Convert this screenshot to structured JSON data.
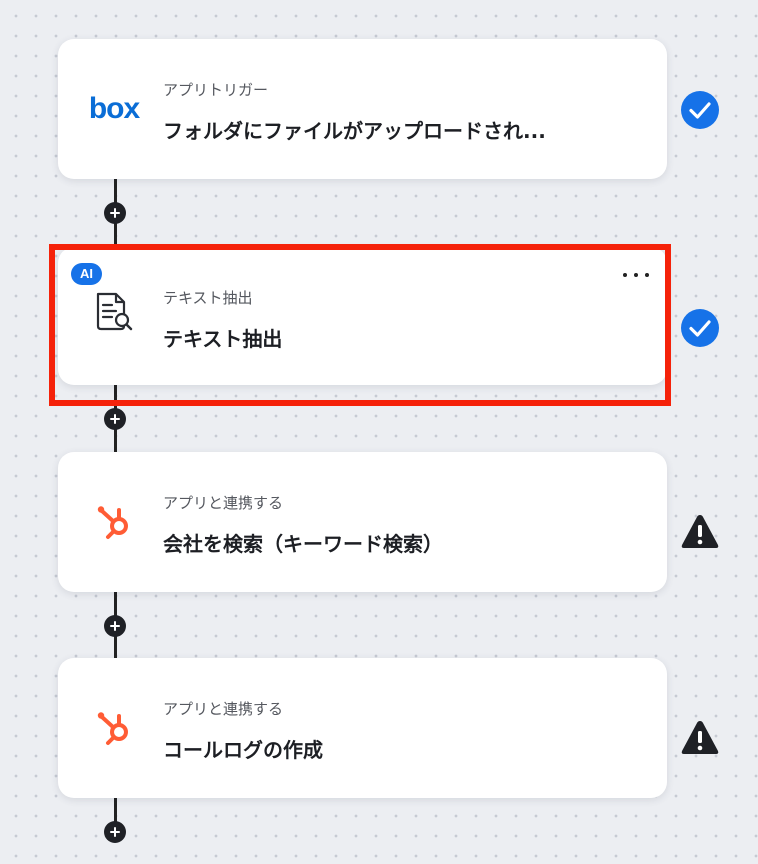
{
  "steps": [
    {
      "app": "box",
      "app_icon": "box-logo",
      "subtitle": "アプリトリガー",
      "title": "フォルダにファイルがアップロードされ...",
      "status": "check-circle-icon"
    },
    {
      "badge": "AI",
      "app_icon": "document-search-icon",
      "subtitle": "テキスト抽出",
      "title": "テキスト抽出",
      "status": "check-circle-icon",
      "selected": true
    },
    {
      "app_icon": "hubspot-icon",
      "subtitle": "アプリと連携する",
      "title": "会社を検索（キーワード検索）",
      "status": "warning-icon"
    },
    {
      "app_icon": "hubspot-icon",
      "subtitle": "アプリと連携する",
      "title": "コールログの作成",
      "status": "warning-icon"
    }
  ],
  "colors": {
    "check": "#1672e8",
    "warning": "#1f2126",
    "highlight": "#f5220a",
    "hubspot": "#ff5c35",
    "box": "#0a6dd6"
  }
}
